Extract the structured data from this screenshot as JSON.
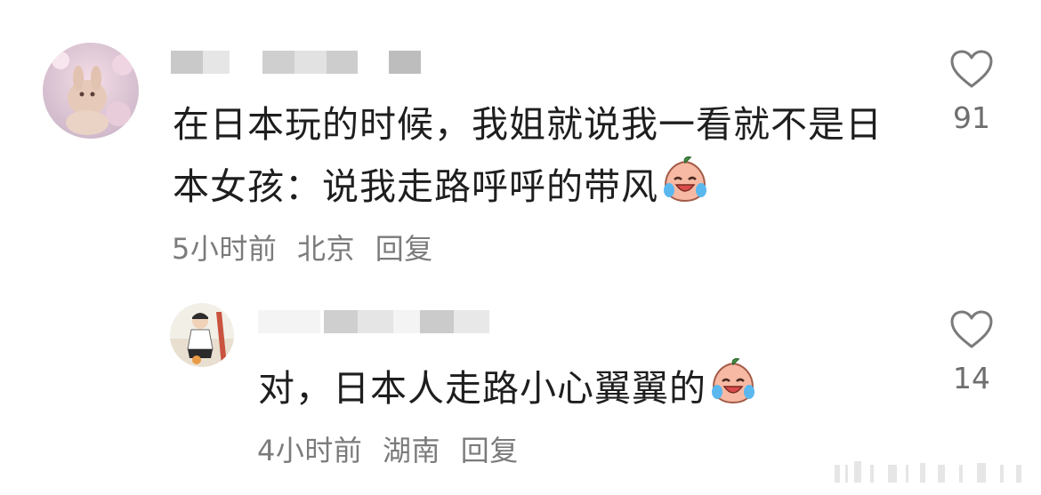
{
  "comments": [
    {
      "text_line1": "在日本玩的时候，我姐就说我一看就不是日",
      "text_line2": "本女孩：说我走路呼呼的带风",
      "time": "5小时前",
      "location": "北京",
      "reply_label": "回复",
      "likes": "91"
    },
    {
      "text_line1": "对，日本人走路小心翼翼的",
      "time": "4小时前",
      "location": "湖南",
      "reply_label": "回复",
      "likes": "14"
    }
  ],
  "icons": {
    "like": "heart-outline-icon",
    "emoji": "crying-laughing-peach-emoji"
  }
}
